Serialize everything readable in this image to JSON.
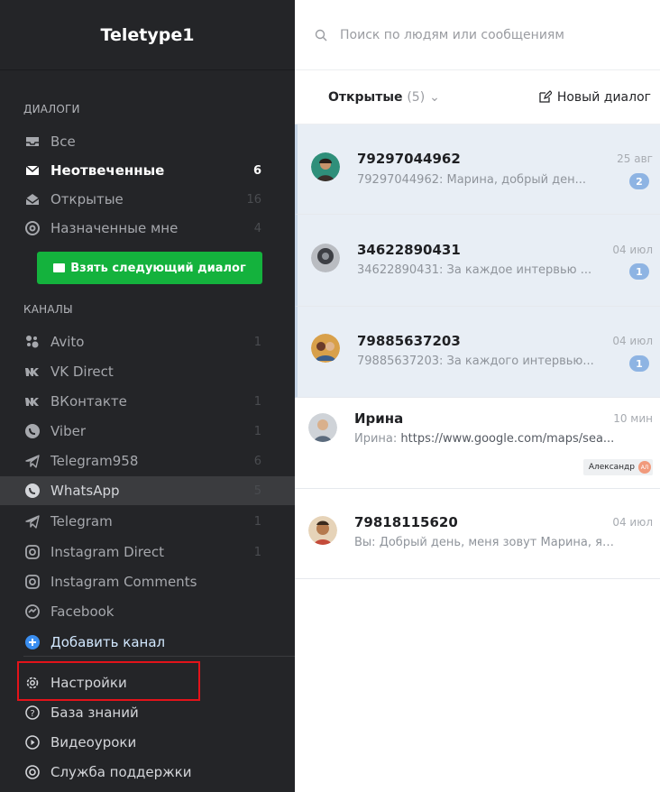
{
  "sidebar": {
    "brand": "Teletype1",
    "dialogs_title": "ДИАЛОГИ",
    "dialogs": [
      {
        "label": "Все",
        "count": "",
        "icon": "inbox-icon"
      },
      {
        "label": "Неотвеченные",
        "count": "6",
        "icon": "envelope-icon"
      },
      {
        "label": "Открытые",
        "count": "16",
        "icon": "open-envelope-icon"
      },
      {
        "label": "Назначенные мне",
        "count": "4",
        "icon": "at-icon"
      }
    ],
    "next_button": "Взять следующий диалог",
    "channels_title": "КАНАЛЫ",
    "channels": [
      {
        "label": "Avito",
        "count": "1",
        "icon": "avito-icon"
      },
      {
        "label": "VK Direct",
        "count": "",
        "icon": "vk-icon"
      },
      {
        "label": "ВКонтакте",
        "count": "1",
        "icon": "vk-icon"
      },
      {
        "label": "Viber",
        "count": "1",
        "icon": "viber-icon"
      },
      {
        "label": "Telegram958",
        "count": "6",
        "icon": "telegram-icon"
      },
      {
        "label": "WhatsApp",
        "count": "5",
        "icon": "whatsapp-icon"
      },
      {
        "label": "Telegram",
        "count": "1",
        "icon": "telegram-icon"
      },
      {
        "label": "Instagram Direct",
        "count": "1",
        "icon": "instagram-icon"
      },
      {
        "label": "Instagram Comments",
        "count": "",
        "icon": "instagram-icon"
      },
      {
        "label": "Facebook",
        "count": "",
        "icon": "messenger-icon"
      }
    ],
    "add_channel": "Добавить канал",
    "footer": [
      {
        "label": "Настройки",
        "icon": "gear-icon"
      },
      {
        "label": "База знаний",
        "icon": "question-icon"
      },
      {
        "label": "Видеоуроки",
        "icon": "play-icon"
      },
      {
        "label": "Служба поддержки",
        "icon": "support-icon"
      }
    ]
  },
  "main": {
    "search_placeholder": "Поиск по людям или сообщениям",
    "filter_label": "Открытые",
    "filter_count": "(5)",
    "new_dialog": "Новый диалог",
    "conversations": [
      {
        "name": "79297044962",
        "time": "25 авг",
        "preview": "79297044962: Марина, добрый ден...",
        "badge": "2"
      },
      {
        "name": "34622890431",
        "time": "04 июл",
        "preview": "34622890431: За каждое интервью ...",
        "badge": "1"
      },
      {
        "name": "79885637203",
        "time": "04 июл",
        "preview": "79885637203: За каждого интервью...",
        "badge": "1"
      },
      {
        "name": "Ирина",
        "time": "10 мин",
        "preview_prefix": "Ирина: ",
        "preview": "https://www.google.com/maps/sea...",
        "agent": "Александр",
        "agent_initials": "АЛ"
      },
      {
        "name": "79818115620",
        "time": "04 июл",
        "preview": "Вы: Добрый день, меня зовут Марина, я ра..."
      }
    ]
  },
  "colors": {
    "sidebar_bg": "#242528",
    "accent_green": "#14b23d",
    "badge_blue": "#8eb4e3",
    "unread_bg": "#e8eef5",
    "highlight_red": "#e3131a"
  }
}
